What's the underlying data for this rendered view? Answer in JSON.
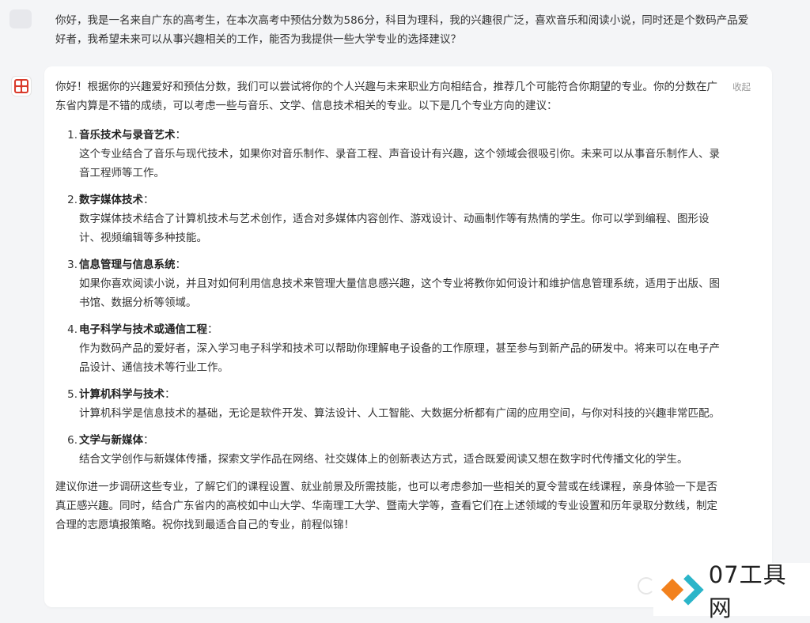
{
  "user_message": {
    "text": "你好，我是一名来自广东的高考生，在本次高考中预估分数为586分，科目为理科，我的兴趣很广泛，喜欢音乐和阅读小说，同时还是个数码产品爱好者，我希望未来可以从事兴趣相关的工作，能否为我提供一些大学专业的选择建议？"
  },
  "assistant_message": {
    "collapse_label": "收起",
    "intro": "你好！根据你的兴趣爱好和预估分数，我们可以尝试将你的个人兴趣与未来职业方向相结合，推荐几个可能符合你期望的专业。你的分数在广东省内算是不错的成绩，可以考虑一些与音乐、文学、信息技术相关的专业。以下是几个专业方向的建议：",
    "items": [
      {
        "num": "1.",
        "title": "音乐技术与录音艺术",
        "colon": "：",
        "desc": "这个专业结合了音乐与现代技术，如果你对音乐制作、录音工程、声音设计有兴趣，这个领域会很吸引你。未来可以从事音乐制作人、录音工程师等工作。"
      },
      {
        "num": "2.",
        "title": "数字媒体技术",
        "colon": "：",
        "desc": "数字媒体技术结合了计算机技术与艺术创作，适合对多媒体内容创作、游戏设计、动画制作等有热情的学生。你可以学到编程、图形设计、视频编辑等多种技能。"
      },
      {
        "num": "3.",
        "title": "信息管理与信息系统",
        "colon": "：",
        "desc": "如果你喜欢阅读小说，并且对如何利用信息技术来管理大量信息感兴趣，这个专业将教你如何设计和维护信息管理系统，适用于出版、图书馆、数据分析等领域。"
      },
      {
        "num": "4.",
        "title": "电子科学与技术或通信工程",
        "colon": "：",
        "desc": "作为数码产品的爱好者，深入学习电子科学和技术可以帮助你理解电子设备的工作原理，甚至参与到新产品的研发中。将来可以在电子产品设计、通信技术等行业工作。"
      },
      {
        "num": "5.",
        "title": "计算机科学与技术",
        "colon": "：",
        "desc": "计算机科学是信息技术的基础，无论是软件开发、算法设计、人工智能、大数据分析都有广阔的应用空间，与你对科技的兴趣非常匹配。"
      },
      {
        "num": "6.",
        "title": "文学与新媒体",
        "colon": "：",
        "desc": "结合文学创作与新媒体传播，探索文学作品在网络、社交媒体上的创新表达方式，适合既爱阅读又想在数字时代传播文化的学生。"
      }
    ],
    "closing": "建议你进一步调研这些专业，了解它们的课程设置、就业前景及所需技能，也可以考虑参加一些相关的夏令营或在线课程，亲身体验一下是否真正感兴趣。同时，结合广东省内的高校如中山大学、华南理工大学、暨南大学等，查看它们在上述领域的专业设置和历年录取分数线，制定合理的志愿填报策略。祝你找到最适合自己的专业，前程似锦！"
  },
  "watermark": {
    "text": "07工具网"
  }
}
